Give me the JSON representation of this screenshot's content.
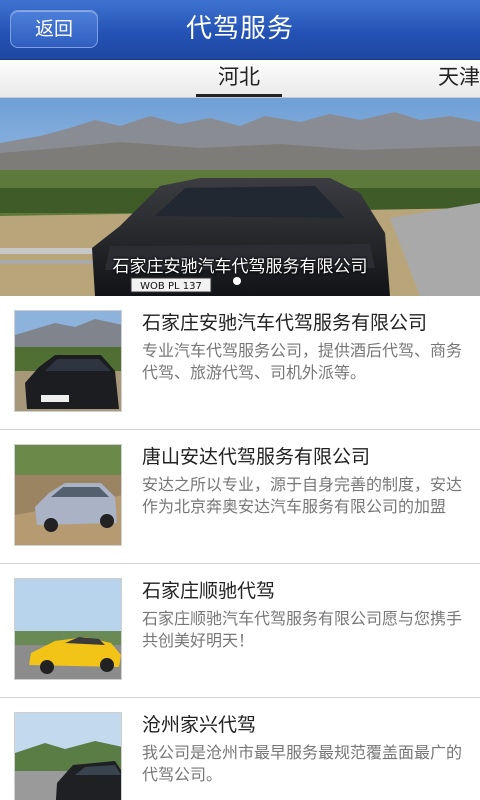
{
  "header": {
    "back_label": "返回",
    "title": "代驾服务"
  },
  "tabs": [
    {
      "label": "河北",
      "selected": true
    },
    {
      "label": "天津",
      "selected": false
    }
  ],
  "banner": {
    "caption": "石家庄安驰汽车代驾服务有限公司",
    "plate": "WOB PL 137",
    "slide": 1,
    "slide_count": 1
  },
  "companies": [
    {
      "name": "石家庄安驰汽车代驾服务有限公司",
      "description": "专业汽车代驾服务公司，提供酒后代驾、商务代驾、旅游代驾、司机外派等。",
      "thumb_plate": "WOB PL 137"
    },
    {
      "name": "唐山安达代驾服务有限公司",
      "description": "安达之所以专业，源于自身完善的制度，安达作为北京奔奥安达汽车服务有限公司的加盟"
    },
    {
      "name": "石家庄顺驰代驾",
      "description": "石家庄顺驰汽车代驾服务有限公司愿与您携手共创美好明天！"
    },
    {
      "name": "沧州家兴代驾",
      "description": "我公司是沧州市最早服务最规范覆盖面最广的代驾公司。"
    }
  ],
  "colors": {
    "header_blue": "#2453b5",
    "title_text": "#222222",
    "desc_text": "#777777"
  }
}
